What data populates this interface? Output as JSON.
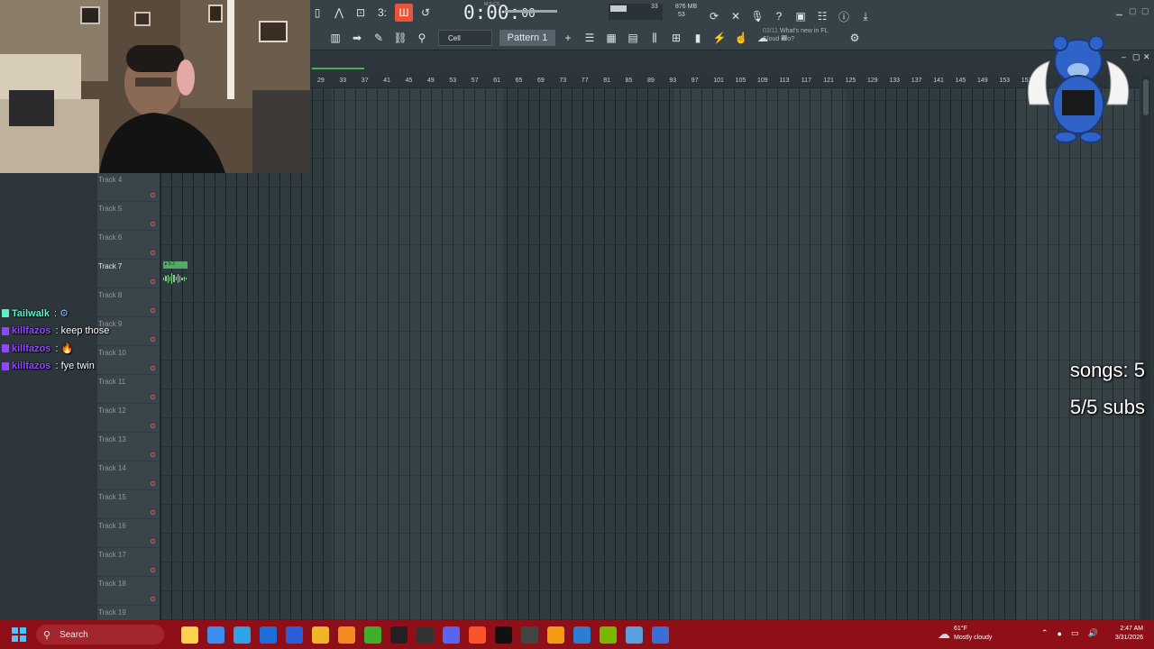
{
  "app": {
    "time_main": "0:00:",
    "time_sub": "00",
    "time_unit_label": "M:S:CS",
    "cpu_value": "33",
    "cpu_value2": "53",
    "memory": "876 MB",
    "snap": "Cell",
    "pattern": "Pattern 1",
    "news_date": "03/11",
    "news_text": "What's new in FL Cloud Pro?"
  },
  "ruler": [
    "29",
    "33",
    "37",
    "41",
    "45",
    "49",
    "53",
    "57",
    "61",
    "65",
    "69",
    "73",
    "77",
    "81",
    "85",
    "89",
    "93",
    "97",
    "101",
    "105",
    "109",
    "113",
    "117",
    "121",
    "125",
    "129",
    "133",
    "137",
    "141",
    "145",
    "149",
    "153",
    "157"
  ],
  "tracks": [
    "Track 4",
    "Track 5",
    "Track 6",
    "Track 7",
    "Track 8",
    "Track 9",
    "Track 10",
    "Track 11",
    "Track 12",
    "Track 13",
    "Track 14",
    "Track 15",
    "Track 16",
    "Track 17",
    "Track 18",
    "Track 19"
  ],
  "selected_track": "Track 7",
  "clip_label": "▸ b 2",
  "chat": [
    {
      "user": "Tailwalk",
      "sep": " : ",
      "message": "",
      "emote": "gear",
      "color": "#5ff0c9"
    },
    {
      "user": "killfazos",
      "sep": " : ",
      "message": "keep those",
      "color": "#9147ff"
    },
    {
      "user": "killfazos",
      "sep": " : ",
      "message": "🔥",
      "color": "#9147ff"
    },
    {
      "user": "killfazos",
      "sep": " : ",
      "message": "fye twin",
      "color": "#9147ff"
    }
  ],
  "overlay": {
    "songs": "songs: 5",
    "subs": "5/5 subs"
  },
  "taskbar": {
    "search": "Search",
    "apps": [
      "file-explorer",
      "copilot",
      "edge",
      "outlook",
      "word",
      "folder",
      "vlc",
      "minecraft",
      "app-ak",
      "app-wave",
      "discord",
      "brave",
      "tiktok",
      "obs",
      "fruity",
      "photos",
      "nvidia",
      "notepad",
      "calculator"
    ],
    "weather_temp": "61°F",
    "weather_desc": "Mostly cloudy",
    "time": "2:47 AM",
    "date": "3/31/2026"
  },
  "colors": {
    "accent": "#e8563a",
    "taskbar": "#8f0f18",
    "clip": "#56a867"
  }
}
